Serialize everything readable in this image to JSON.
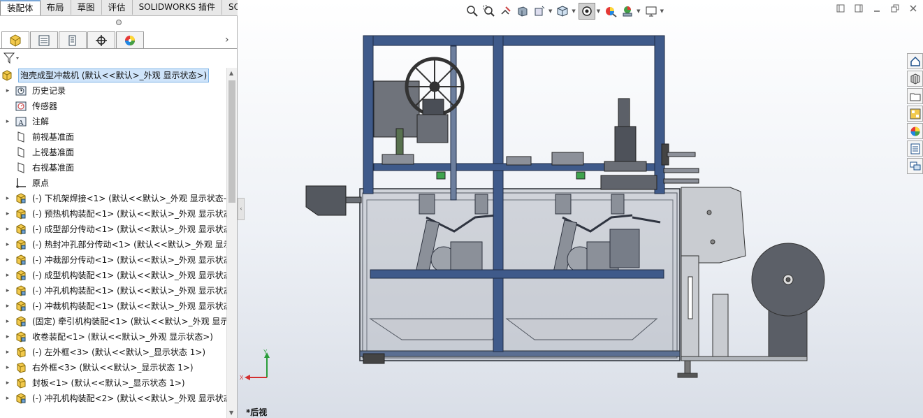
{
  "command_tabs": [
    {
      "label": "装配体",
      "active": true
    },
    {
      "label": "布局"
    },
    {
      "label": "草图"
    },
    {
      "label": "评估"
    },
    {
      "label": "SOLIDWORKS 插件"
    },
    {
      "label": "SOLIDWORKS MBD"
    }
  ],
  "manager_tabs": [
    {
      "name": "featuremanager-tab",
      "icon": "assembly-cube-icon",
      "active": true
    },
    {
      "name": "propertymanager-tab",
      "icon": "property-list-icon"
    },
    {
      "name": "configurationmanager-tab",
      "icon": "configuration-icon"
    },
    {
      "name": "dimxpert-tab",
      "icon": "crosshair-icon"
    },
    {
      "name": "display-manager-tab",
      "icon": "color-wheel-icon"
    }
  ],
  "tree": {
    "root": "泡壳成型冲裁机  (默认<<默认>_外观 显示状态>)",
    "items": [
      {
        "label": "历史记录",
        "icon": "history-icon",
        "expandable": true
      },
      {
        "label": "传感器",
        "icon": "sensor-icon",
        "expandable": false
      },
      {
        "label": "注解",
        "icon": "annotation-icon",
        "expandable": true
      },
      {
        "label": "前视基准面",
        "icon": "plane-icon",
        "expandable": false
      },
      {
        "label": "上视基准面",
        "icon": "plane-icon",
        "expandable": false
      },
      {
        "label": "右视基准面",
        "icon": "plane-icon",
        "expandable": false
      },
      {
        "label": "原点",
        "icon": "origin-icon",
        "expandable": false
      },
      {
        "label": "(-) 下机架焊接<1>  (默认<<默认>_外观 显示状态-",
        "icon": "subassembly-icon",
        "expandable": true
      },
      {
        "label": "(-) 预热机构装配<1>  (默认<<默认>_外观 显示状态",
        "icon": "subassembly-icon",
        "expandable": true
      },
      {
        "label": "(-) 成型部分传动<1>  (默认<<默认>_外观 显示状态",
        "icon": "subassembly-icon",
        "expandable": true
      },
      {
        "label": "(-) 热封冲孔部分传动<1>  (默认<<默认>_外观 显示",
        "icon": "subassembly-icon",
        "expandable": true
      },
      {
        "label": "(-) 冲裁部分传动<1>  (默认<<默认>_外观 显示状态",
        "icon": "subassembly-icon",
        "expandable": true
      },
      {
        "label": "(-) 成型机构装配<1>  (默认<<默认>_外观 显示状态",
        "icon": "subassembly-icon",
        "expandable": true
      },
      {
        "label": "(-) 冲孔机构装配<1>  (默认<<默认>_外观 显示状态",
        "icon": "subassembly-icon",
        "expandable": true
      },
      {
        "label": "(-) 冲裁机构装配<1>  (默认<<默认>_外观 显示状态",
        "icon": "subassembly-icon",
        "expandable": true
      },
      {
        "label": "(固定) 牵引机构装配<1>  (默认<<默认>_外观 显示",
        "icon": "subassembly-icon",
        "expandable": true
      },
      {
        "label": "收卷装配<1>  (默认<<默认>_外观 显示状态>)",
        "icon": "subassembly-icon",
        "expandable": true
      },
      {
        "label": "(-) 左外框<3>  (默认<<默认>_显示状态 1>)",
        "icon": "part-icon",
        "expandable": true
      },
      {
        "label": "右外框<3>  (默认<<默认>_显示状态 1>)",
        "icon": "part-icon",
        "expandable": true
      },
      {
        "label": "封板<1>  (默认<<默认>_显示状态 1>)",
        "icon": "part-icon",
        "expandable": true
      },
      {
        "label": "(-) 冲孔机构装配<2>  (默认<<默认>_外观 显示状态",
        "icon": "subassembly-icon",
        "expandable": true
      }
    ]
  },
  "viewport": {
    "view_name": "*后视",
    "triad": {
      "x": "X",
      "y": "Y"
    }
  },
  "headsup_toolbar": [
    "zoom-to-fit-icon",
    "zoom-to-area-icon",
    "previous-view-icon",
    "section-view-icon",
    "dynamic-annotation-icon",
    "view-orientation-icon",
    "display-style-icon",
    "hide-show-icon",
    "edit-appearance-icon",
    "apply-scene-icon",
    "view-settings-icon"
  ],
  "task_pane": [
    "home-icon",
    "design-library-icon",
    "file-explorer-icon",
    "view-palette-icon",
    "appearances-icon",
    "custom-properties-icon",
    "forum-icon"
  ],
  "colors": {
    "frame_blue": "#3f5a8a",
    "panel_grey": "#9ea3ab",
    "selection": "#cfe4fa"
  }
}
